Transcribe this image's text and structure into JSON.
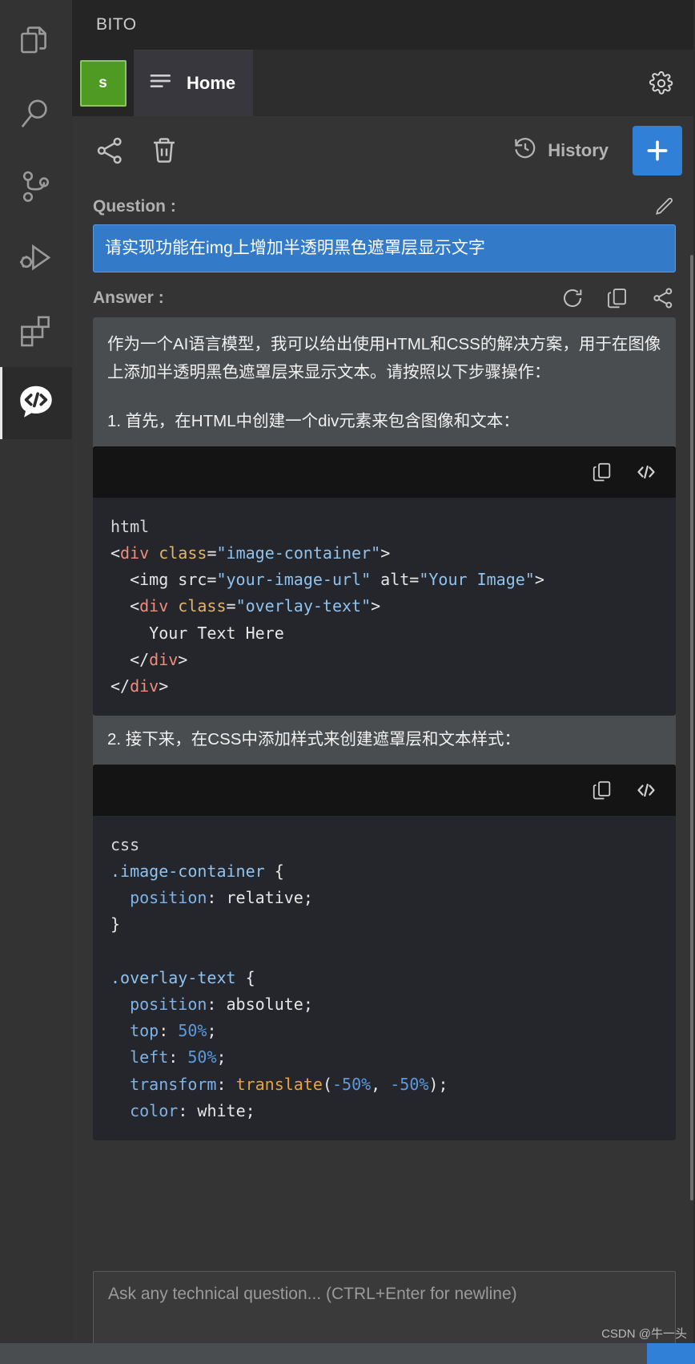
{
  "activitybar": {
    "items": [
      {
        "name": "explorer",
        "icon": "files-icon",
        "active": false
      },
      {
        "name": "search",
        "icon": "search-icon",
        "active": false
      },
      {
        "name": "source-control",
        "icon": "source-control-icon",
        "active": false
      },
      {
        "name": "run-and-debug",
        "icon": "run-debug-icon",
        "active": false
      },
      {
        "name": "extensions",
        "icon": "extensions-icon",
        "active": false
      },
      {
        "name": "bito",
        "icon": "bito-code-chat-icon",
        "active": true
      }
    ]
  },
  "panel": {
    "title": "BITO",
    "avatar_letter": "s",
    "tab_label": "Home",
    "settings_icon": "gear-icon"
  },
  "actionbar": {
    "share_icon": "share-icon",
    "delete_icon": "trash-icon",
    "history_label": "History",
    "history_icon": "history-clock-icon",
    "new_chat_label": "+",
    "new_chat_color": "#2f80d6"
  },
  "conversation": {
    "question_label": "Question :",
    "question_edit_icon": "pencil-icon",
    "question_text": "请实现功能在img上增加半透明黑色遮罩层显示文字",
    "question_bubble_color": "#337ac8",
    "answer_label": "Answer :",
    "answer_icons": [
      "refresh-icon",
      "copy-icon",
      "share-icon"
    ],
    "answer_intro": "作为一个AI语言模型，我可以给出使用HTML和CSS的解决方案，用于在图像上添加半透明黑色遮罩层来显示文本。请按照以下步骤操作：",
    "step1_text": "1. 首先，在HTML中创建一个div元素来包含图像和文本：",
    "step2_text": "2. 接下来，在CSS中添加样式来创建遮罩层和文本样式：",
    "code_blocks": [
      {
        "language": "html",
        "copy_icon": "copy-icon",
        "insert_icon": "code-insert-icon",
        "lines": [
          [
            {
              "t": "html",
              "c": "lang"
            }
          ],
          [
            {
              "t": "<",
              "c": "punct"
            },
            {
              "t": "div",
              "c": "tag"
            },
            {
              "t": " ",
              "c": "punct"
            },
            {
              "t": "class",
              "c": "attr"
            },
            {
              "t": "=",
              "c": "punct"
            },
            {
              "t": "\"image-container\"",
              "c": "str"
            },
            {
              "t": ">",
              "c": "punct"
            }
          ],
          [
            {
              "t": "  <img ",
              "c": "punct"
            },
            {
              "t": "src=",
              "c": "punct"
            },
            {
              "t": "\"your-image-url\"",
              "c": "str"
            },
            {
              "t": " alt=",
              "c": "punct"
            },
            {
              "t": "\"Your Image\"",
              "c": "str"
            },
            {
              "t": ">",
              "c": "punct"
            }
          ],
          [
            {
              "t": "  <",
              "c": "punct"
            },
            {
              "t": "div",
              "c": "tag"
            },
            {
              "t": " ",
              "c": "punct"
            },
            {
              "t": "class",
              "c": "attr"
            },
            {
              "t": "=",
              "c": "punct"
            },
            {
              "t": "\"overlay-text\"",
              "c": "str"
            },
            {
              "t": ">",
              "c": "punct"
            }
          ],
          [
            {
              "t": "    Your Text Here",
              "c": "punct"
            }
          ],
          [
            {
              "t": "  </",
              "c": "punct"
            },
            {
              "t": "div",
              "c": "tag"
            },
            {
              "t": ">",
              "c": "punct"
            }
          ],
          [
            {
              "t": "</",
              "c": "punct"
            },
            {
              "t": "div",
              "c": "tag"
            },
            {
              "t": ">",
              "c": "punct"
            }
          ]
        ]
      },
      {
        "language": "css",
        "copy_icon": "copy-icon",
        "insert_icon": "code-insert-icon",
        "lines": [
          [
            {
              "t": "css",
              "c": "lang"
            }
          ],
          [
            {
              "t": ".image-container",
              "c": "sel"
            },
            {
              "t": " {",
              "c": "brace"
            }
          ],
          [
            {
              "t": "  ",
              "c": "punct"
            },
            {
              "t": "position",
              "c": "prop"
            },
            {
              "t": ": ",
              "c": "punct"
            },
            {
              "t": "relative;",
              "c": "val"
            }
          ],
          [
            {
              "t": "}",
              "c": "brace"
            }
          ],
          [
            {
              "t": "",
              "c": "punct"
            }
          ],
          [
            {
              "t": ".overlay-text",
              "c": "sel"
            },
            {
              "t": " {",
              "c": "brace"
            }
          ],
          [
            {
              "t": "  ",
              "c": "punct"
            },
            {
              "t": "position",
              "c": "prop"
            },
            {
              "t": ": ",
              "c": "punct"
            },
            {
              "t": "absolute;",
              "c": "val"
            }
          ],
          [
            {
              "t": "  ",
              "c": "punct"
            },
            {
              "t": "top",
              "c": "prop"
            },
            {
              "t": ": ",
              "c": "punct"
            },
            {
              "t": "50%",
              "c": "num"
            },
            {
              "t": ";",
              "c": "val"
            }
          ],
          [
            {
              "t": "  ",
              "c": "punct"
            },
            {
              "t": "left",
              "c": "prop"
            },
            {
              "t": ": ",
              "c": "punct"
            },
            {
              "t": "50%",
              "c": "num"
            },
            {
              "t": ";",
              "c": "val"
            }
          ],
          [
            {
              "t": "  ",
              "c": "punct"
            },
            {
              "t": "transform",
              "c": "prop"
            },
            {
              "t": ": ",
              "c": "punct"
            },
            {
              "t": "translate",
              "c": "fn"
            },
            {
              "t": "(",
              "c": "val"
            },
            {
              "t": "-50%",
              "c": "num"
            },
            {
              "t": ", ",
              "c": "val"
            },
            {
              "t": "-50%",
              "c": "num"
            },
            {
              "t": ");",
              "c": "val"
            }
          ],
          [
            {
              "t": "  ",
              "c": "punct"
            },
            {
              "t": "color",
              "c": "prop"
            },
            {
              "t": ": ",
              "c": "punct"
            },
            {
              "t": "white;",
              "c": "val"
            }
          ]
        ]
      }
    ]
  },
  "compose": {
    "placeholder": "Ask any technical question... (CTRL+Enter for newline)"
  },
  "watermark": "CSDN @牛一头"
}
